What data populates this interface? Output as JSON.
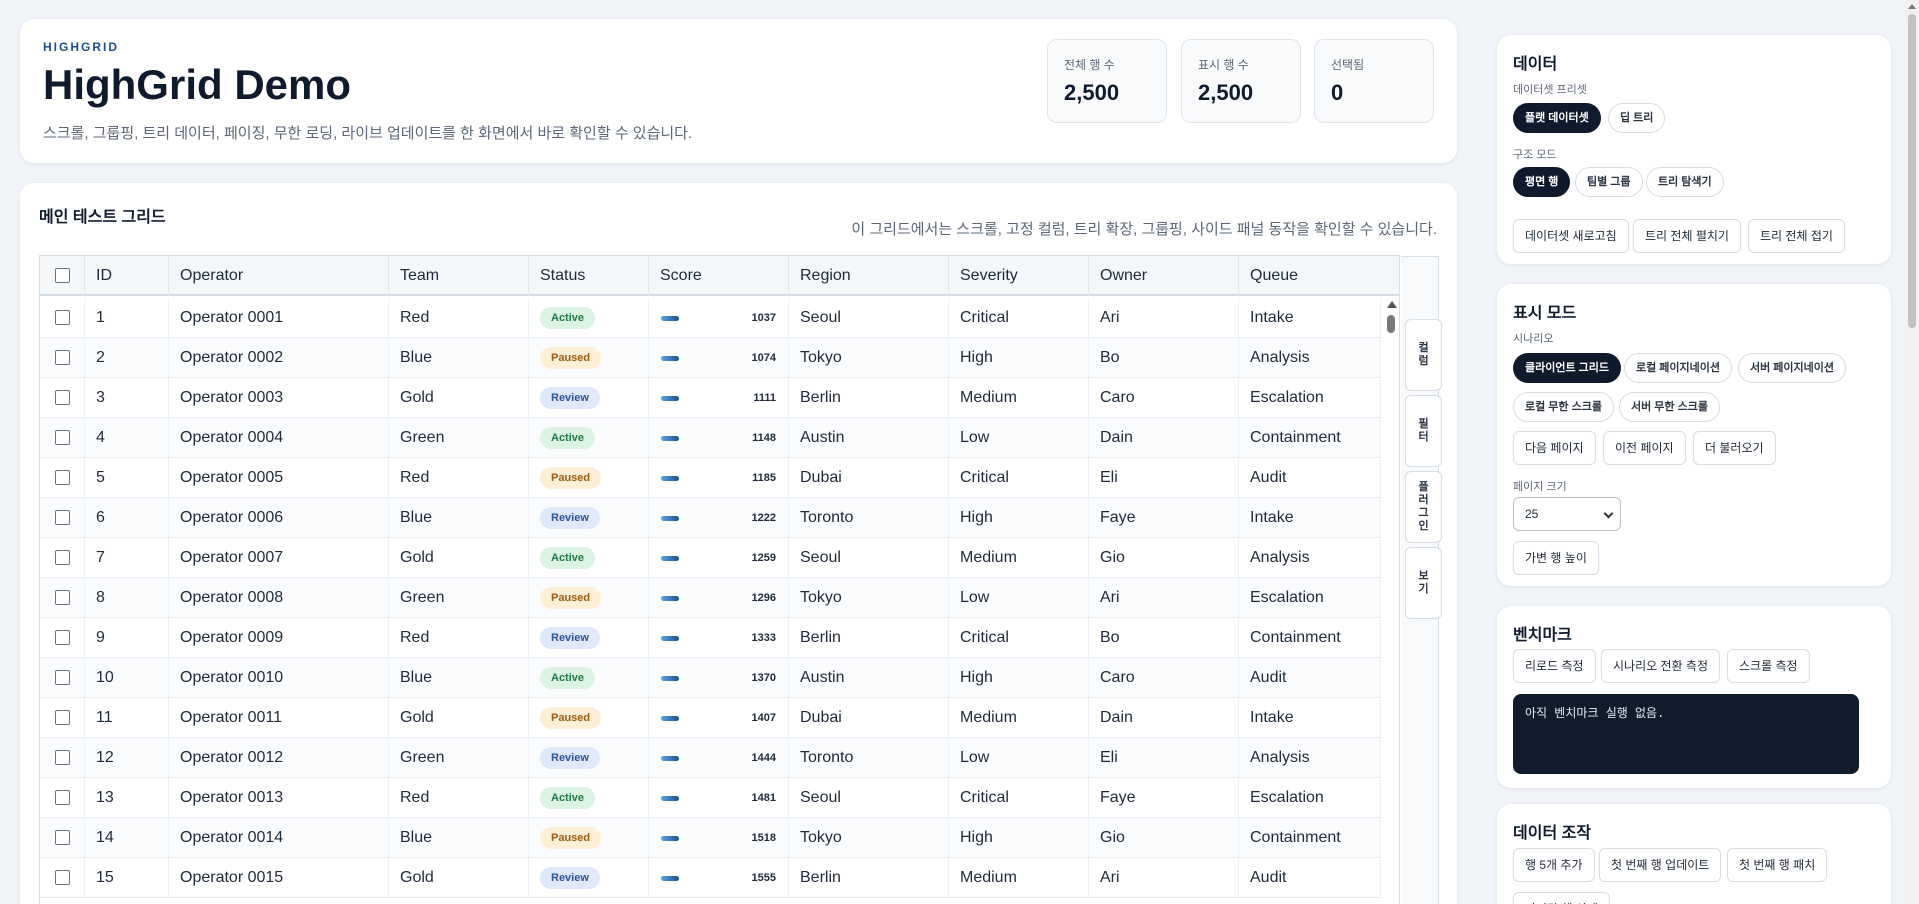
{
  "header": {
    "eyebrow": "HIGHGRID",
    "title": "HighGrid Demo",
    "subtitle": "스크롤, 그룹핑, 트리 데이터, 페이징, 무한 로딩, 라이브 업데이트를 한 화면에서 바로 확인할 수 있습니다.",
    "stats": [
      {
        "label": "전체 행 수",
        "value": "2,500"
      },
      {
        "label": "표시 행 수",
        "value": "2,500"
      },
      {
        "label": "선택됨",
        "value": "0"
      }
    ]
  },
  "grid": {
    "title": "메인 테스트 그리드",
    "description": "이 그리드에서는 스크롤, 고정 컬럼, 트리 확장, 그룹핑, 사이드 패널 동작을 확인할 수 있습니다.",
    "columns": [
      "ID",
      "Operator",
      "Team",
      "Status",
      "Score",
      "Region",
      "Severity",
      "Owner",
      "Queue"
    ],
    "rows": [
      {
        "id": "1",
        "operator": "Operator 0001",
        "team": "Red",
        "status": "Active",
        "score": "1037",
        "region": "Seoul",
        "severity": "Critical",
        "owner": "Ari",
        "queue": "Intake"
      },
      {
        "id": "2",
        "operator": "Operator 0002",
        "team": "Blue",
        "status": "Paused",
        "score": "1074",
        "region": "Tokyo",
        "severity": "High",
        "owner": "Bo",
        "queue": "Analysis"
      },
      {
        "id": "3",
        "operator": "Operator 0003",
        "team": "Gold",
        "status": "Review",
        "score": "1111",
        "region": "Berlin",
        "severity": "Medium",
        "owner": "Caro",
        "queue": "Escalation"
      },
      {
        "id": "4",
        "operator": "Operator 0004",
        "team": "Green",
        "status": "Active",
        "score": "1148",
        "region": "Austin",
        "severity": "Low",
        "owner": "Dain",
        "queue": "Containment"
      },
      {
        "id": "5",
        "operator": "Operator 0005",
        "team": "Red",
        "status": "Paused",
        "score": "1185",
        "region": "Dubai",
        "severity": "Critical",
        "owner": "Eli",
        "queue": "Audit"
      },
      {
        "id": "6",
        "operator": "Operator 0006",
        "team": "Blue",
        "status": "Review",
        "score": "1222",
        "region": "Toronto",
        "severity": "High",
        "owner": "Faye",
        "queue": "Intake"
      },
      {
        "id": "7",
        "operator": "Operator 0007",
        "team": "Gold",
        "status": "Active",
        "score": "1259",
        "region": "Seoul",
        "severity": "Medium",
        "owner": "Gio",
        "queue": "Analysis"
      },
      {
        "id": "8",
        "operator": "Operator 0008",
        "team": "Green",
        "status": "Paused",
        "score": "1296",
        "region": "Tokyo",
        "severity": "Low",
        "owner": "Ari",
        "queue": "Escalation"
      },
      {
        "id": "9",
        "operator": "Operator 0009",
        "team": "Red",
        "status": "Review",
        "score": "1333",
        "region": "Berlin",
        "severity": "Critical",
        "owner": "Bo",
        "queue": "Containment"
      },
      {
        "id": "10",
        "operator": "Operator 0010",
        "team": "Blue",
        "status": "Active",
        "score": "1370",
        "region": "Austin",
        "severity": "High",
        "owner": "Caro",
        "queue": "Audit"
      },
      {
        "id": "11",
        "operator": "Operator 0011",
        "team": "Gold",
        "status": "Paused",
        "score": "1407",
        "region": "Dubai",
        "severity": "Medium",
        "owner": "Dain",
        "queue": "Intake"
      },
      {
        "id": "12",
        "operator": "Operator 0012",
        "team": "Green",
        "status": "Review",
        "score": "1444",
        "region": "Toronto",
        "severity": "Low",
        "owner": "Eli",
        "queue": "Analysis"
      },
      {
        "id": "13",
        "operator": "Operator 0013",
        "team": "Red",
        "status": "Active",
        "score": "1481",
        "region": "Seoul",
        "severity": "Critical",
        "owner": "Faye",
        "queue": "Escalation"
      },
      {
        "id": "14",
        "operator": "Operator 0014",
        "team": "Blue",
        "status": "Paused",
        "score": "1518",
        "region": "Tokyo",
        "severity": "High",
        "owner": "Gio",
        "queue": "Containment"
      },
      {
        "id": "15",
        "operator": "Operator 0015",
        "team": "Gold",
        "status": "Review",
        "score": "1555",
        "region": "Berlin",
        "severity": "Medium",
        "owner": "Ari",
        "queue": "Audit"
      }
    ],
    "side_tabs": [
      "컬럼",
      "필터",
      "플러그인",
      "보기"
    ]
  },
  "panel_data": {
    "title": "데이터",
    "preset_label": "데이터셋 프리셋",
    "presets": [
      "플랫 데이터셋",
      "딥 트리"
    ],
    "structure_label": "구조 모드",
    "structures": [
      "평면 행",
      "팀별 그룹",
      "트리 탐색기"
    ],
    "actions": [
      "데이터셋 새로고침",
      "트리 전체 펼치기",
      "트리 전체 접기"
    ]
  },
  "panel_display": {
    "title": "표시 모드",
    "scenario_label": "시나리오",
    "scenarios": [
      "클라이언트 그리드",
      "로컬 페이지네이션",
      "서버 페이지네이션",
      "로컬 무한 스크롤",
      "서버 무한 스크롤"
    ],
    "nav": [
      "다음 페이지",
      "이전 페이지",
      "더 불러오기"
    ],
    "page_size_label": "페이지 크기",
    "page_size": "25",
    "variable_height": "가변 행 높이"
  },
  "panel_bench": {
    "title": "벤치마크",
    "actions": [
      "리로드 측정",
      "시나리오 전환 측정",
      "스크롤 측정"
    ],
    "console": "아직 벤치마크 실행 없음."
  },
  "panel_ops": {
    "title": "데이터 조작",
    "actions": [
      "행 5개 추가",
      "첫 번째 행 업데이트",
      "첫 번째 행 패치",
      "마지막 행 삭제"
    ]
  },
  "colors": {
    "accent": "#0f1b2d",
    "active": "#207a44",
    "paused": "#9a5d0d",
    "review": "#2c5597"
  }
}
